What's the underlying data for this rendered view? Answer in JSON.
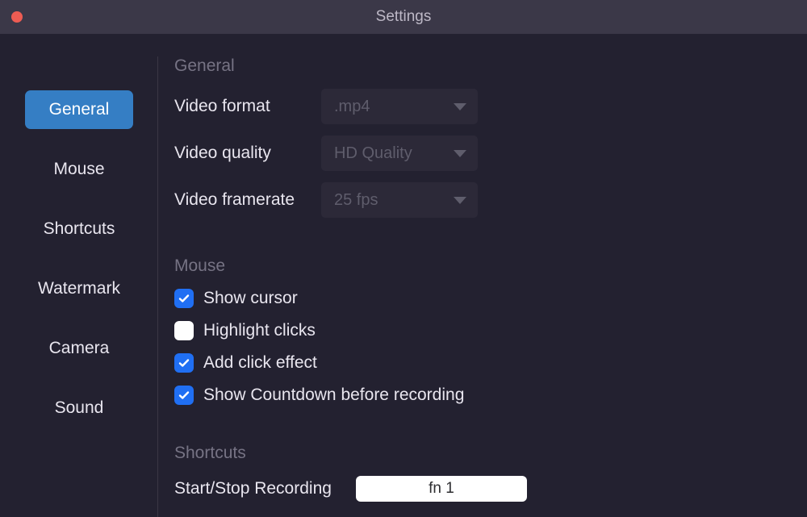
{
  "window": {
    "title": "Settings"
  },
  "sidebar": {
    "items": [
      {
        "label": "General",
        "active": true
      },
      {
        "label": "Mouse",
        "active": false
      },
      {
        "label": "Shortcuts",
        "active": false
      },
      {
        "label": "Watermark",
        "active": false
      },
      {
        "label": "Camera",
        "active": false
      },
      {
        "label": "Sound",
        "active": false
      }
    ]
  },
  "sections": {
    "general": {
      "header": "General",
      "videoFormat": {
        "label": "Video format",
        "value": ".mp4"
      },
      "videoQuality": {
        "label": "Video quality",
        "value": "HD Quality"
      },
      "videoFramerate": {
        "label": "Video framerate",
        "value": "25 fps"
      }
    },
    "mouse": {
      "header": "Mouse",
      "showCursor": {
        "label": "Show cursor",
        "checked": true
      },
      "highlightClicks": {
        "label": "Highlight clicks",
        "checked": false
      },
      "addClickEffect": {
        "label": "Add click effect",
        "checked": true
      },
      "showCountdown": {
        "label": "Show Countdown before recording",
        "checked": true
      }
    },
    "shortcuts": {
      "header": "Shortcuts",
      "startStop": {
        "label": "Start/Stop Recording",
        "value": "fn 1"
      }
    }
  }
}
